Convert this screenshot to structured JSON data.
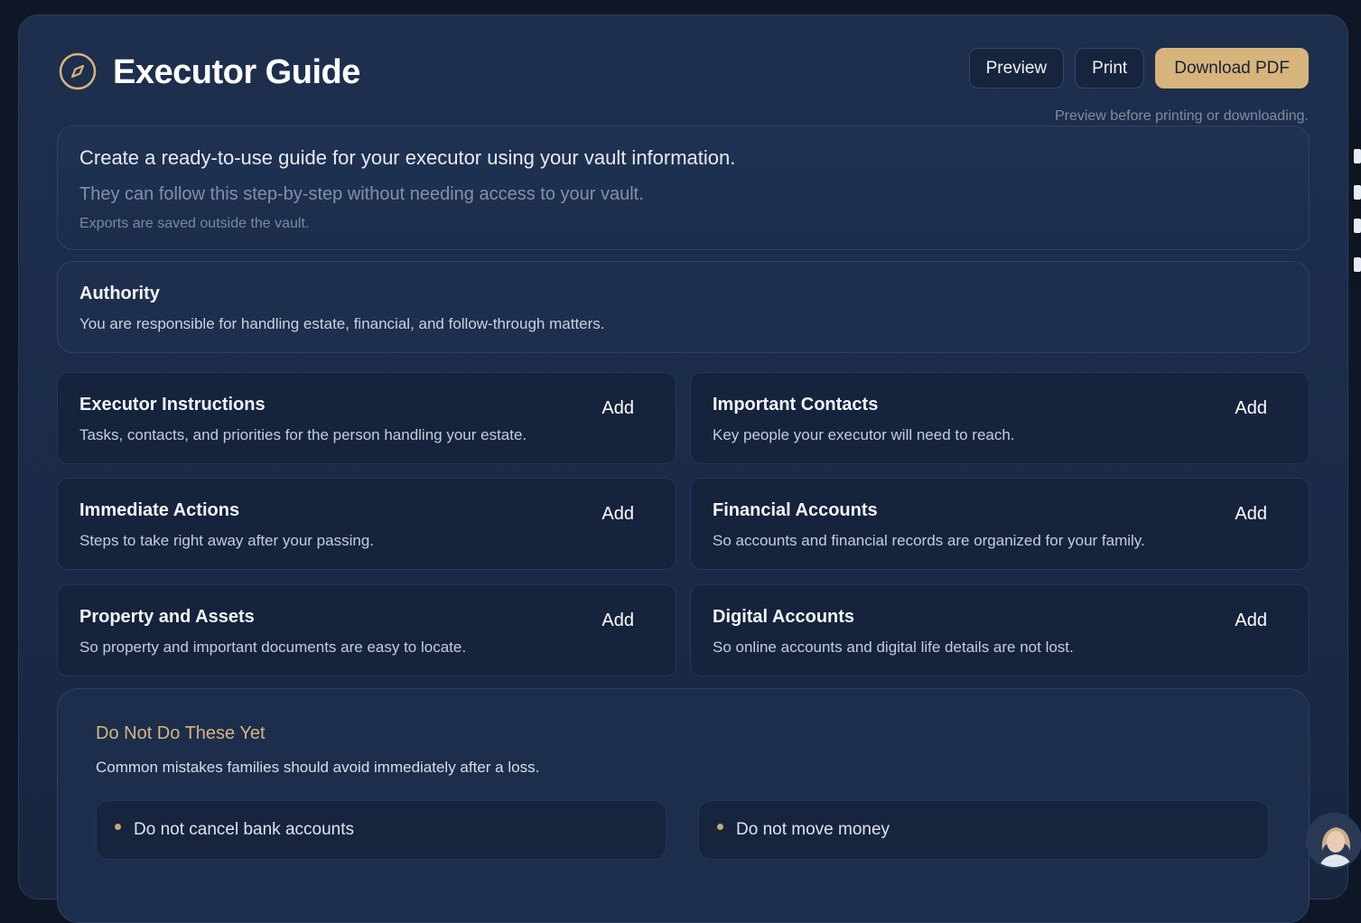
{
  "header": {
    "title": "Executor Guide",
    "icon": "compass-icon",
    "accent": "#d6b47c",
    "buttons": {
      "preview": "Preview",
      "print": "Print",
      "download": "Download PDF"
    },
    "hint": "Preview before printing or downloading."
  },
  "intro": {
    "line1": "Create a ready-to-use guide for your executor using your vault information.",
    "line2": "They can follow this step-by-step without needing access to your vault.",
    "line3": "Exports are saved outside the vault."
  },
  "authority": {
    "title": "Authority",
    "description": "You are responsible for handling estate, financial, and follow-through matters."
  },
  "sections": [
    {
      "title": "Executor Instructions",
      "description": "Tasks, contacts, and priorities for the person handling your estate.",
      "action": "Add"
    },
    {
      "title": "Important Contacts",
      "description": "Key people your executor will need to reach.",
      "action": "Add"
    },
    {
      "title": "Immediate Actions",
      "description": "Steps to take right away after your passing.",
      "action": "Add"
    },
    {
      "title": "Financial Accounts",
      "description": "So accounts and financial records are organized for your family.",
      "action": "Add"
    },
    {
      "title": "Property and Assets",
      "description": "So property and important documents are easy to locate.",
      "action": "Add"
    },
    {
      "title": "Digital Accounts",
      "description": "So online accounts and digital life details are not lost.",
      "action": "Add"
    }
  ],
  "do_not": {
    "title": "Do Not Do These Yet",
    "description": "Common mistakes families should avoid immediately after a loss.",
    "items": [
      "Do not cancel bank accounts",
      "Do not move money"
    ]
  }
}
